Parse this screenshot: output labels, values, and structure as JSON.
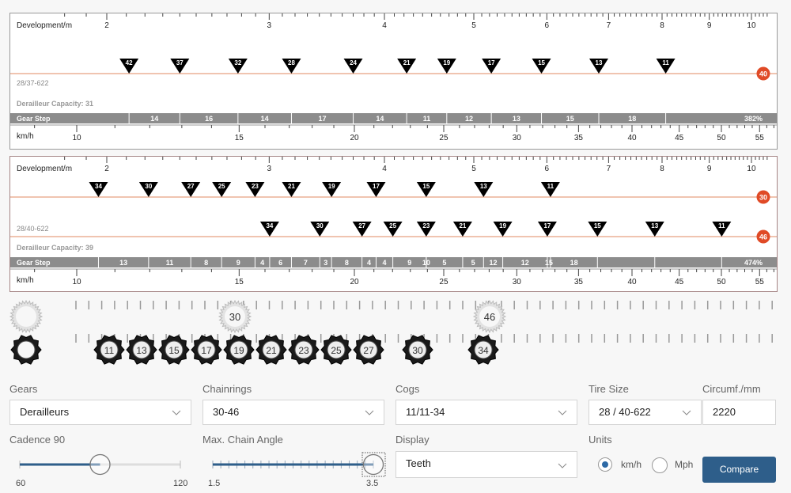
{
  "charts": [
    {
      "dev_label": "Development/m",
      "tire_label": "28/37-622",
      "capacity": "Derailleur Capacity: 31",
      "gear_step_label": "Gear Step",
      "speed_label": "km/h",
      "rings": [
        {
          "teeth": 40,
          "cogs": [
            42,
            37,
            32,
            28,
            24,
            21,
            19,
            17,
            15,
            13,
            11
          ]
        }
      ],
      "gear_steps": [
        "14",
        "16",
        "14",
        "17",
        "14",
        "11",
        "12",
        "13",
        "15",
        "18"
      ],
      "range": "382%"
    },
    {
      "dev_label": "Development/m",
      "tire_label": "28/40-622",
      "capacity": "Derailleur Capacity: 39",
      "gear_step_label": "Gear Step",
      "speed_label": "km/h",
      "rings": [
        {
          "teeth": 30,
          "cogs": [
            34,
            30,
            27,
            25,
            23,
            21,
            19,
            17,
            15,
            13,
            11
          ]
        },
        {
          "teeth": 46,
          "cogs": [
            34,
            30,
            27,
            25,
            23,
            21,
            19,
            17,
            15,
            13,
            11
          ]
        }
      ],
      "gear_steps": [
        "13",
        "11",
        "8",
        "9",
        "4",
        "6",
        "7",
        "3",
        "8",
        "4",
        "4",
        "9",
        "10",
        "5",
        "5",
        "12",
        "12",
        "15",
        "18"
      ],
      "range": "474%"
    }
  ],
  "dev_ticks": [
    2,
    3,
    4,
    5,
    6,
    7,
    8,
    9,
    10
  ],
  "speed_ticks": [
    10,
    15,
    20,
    25,
    30,
    35,
    40,
    45,
    50,
    55
  ],
  "colors": {
    "ring_badge": "#e04a26",
    "ring_line": "#e8a080",
    "gear_step_bg": "#8c8c8c",
    "accent": "#2e5e8a",
    "marker": "#000000"
  },
  "drivetrain": {
    "chainrings": [
      "",
      "30",
      "46"
    ],
    "cogs": [
      "",
      "11",
      "13",
      "15",
      "17",
      "19",
      "21",
      "23",
      "25",
      "27",
      "30",
      "34"
    ]
  },
  "form": {
    "gears": {
      "label": "Gears",
      "value": "Derailleurs"
    },
    "chainrings": {
      "label": "Chainrings",
      "value": "30-46"
    },
    "cogs": {
      "label": "Cogs",
      "value": "11/11-34"
    },
    "tire_size": {
      "label": "Tire Size",
      "value": "28 / 40-622"
    },
    "circumference": {
      "label": "Circumf./mm",
      "value": "2220"
    },
    "cadence": {
      "label": "Cadence 90",
      "min": "60",
      "max": "120",
      "value": 90
    },
    "chain_angle": {
      "label": "Max. Chain Angle",
      "min": "1.5",
      "max": "3.5",
      "value": 3.5
    },
    "display": {
      "label": "Display",
      "value": "Teeth"
    },
    "units": {
      "label": "Units",
      "options": [
        "km/h",
        "Mph"
      ],
      "selected": "km/h"
    },
    "compare_label": "Compare"
  }
}
